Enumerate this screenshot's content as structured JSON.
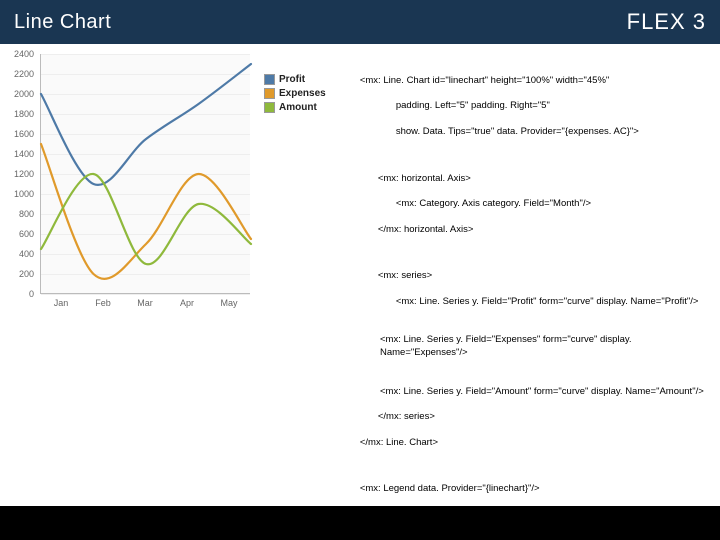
{
  "header": {
    "title": "Line Chart",
    "brand": "FLEX 3"
  },
  "legend": [
    {
      "label": "Profit",
      "color": "#4e7aa7"
    },
    {
      "label": "Expenses",
      "color": "#e09a2b"
    },
    {
      "label": "Amount",
      "color": "#8fb93c"
    }
  ],
  "chart_data": {
    "type": "line",
    "categories": [
      "Jan",
      "Feb",
      "Mar",
      "Apr",
      "May"
    ],
    "ylim": [
      0,
      2400
    ],
    "y_ticks": [
      0,
      200,
      400,
      600,
      800,
      1000,
      1200,
      1400,
      1600,
      1800,
      2000,
      2200,
      2400
    ],
    "series": [
      {
        "name": "Profit",
        "color": "#4e7aa7",
        "values": [
          2000,
          1100,
          1550,
          1900,
          2300
        ]
      },
      {
        "name": "Expenses",
        "color": "#e09a2b",
        "values": [
          1500,
          200,
          500,
          1200,
          550
        ]
      },
      {
        "name": "Amount",
        "color": "#8fb93c",
        "values": [
          450,
          1200,
          300,
          900,
          500
        ]
      }
    ],
    "title": "",
    "xlabel": "",
    "ylabel": ""
  },
  "code": {
    "l1": "<mx: Line. Chart id=\"linechart\" height=\"100%\" width=\"45%\"",
    "l2": "padding. Left=\"5\" padding. Right=\"5\"",
    "l3": "show. Data. Tips=\"true\" data. Provider=\"{expenses. AC}\">",
    "l4": "<mx: horizontal. Axis>",
    "l5": "<mx: Category. Axis category. Field=\"Month\"/>",
    "l6": "</mx: horizontal. Axis>",
    "l7": "<mx: series>",
    "l8": "<mx: Line. Series y. Field=\"Profit\" form=\"curve\" display. Name=\"Profit\"/>",
    "l9": "<mx: Line. Series y. Field=\"Expenses\" form=\"curve\" display. Name=\"Expenses\"/>",
    "l10": "<mx: Line. Series y. Field=\"Amount\" form=\"curve\" display. Name=\"Amount\"/>",
    "l11": "</mx: series>",
    "l12": "</mx: Line. Chart>",
    "l13": "<mx: Legend data. Provider=\"{linechart}\"/>"
  }
}
